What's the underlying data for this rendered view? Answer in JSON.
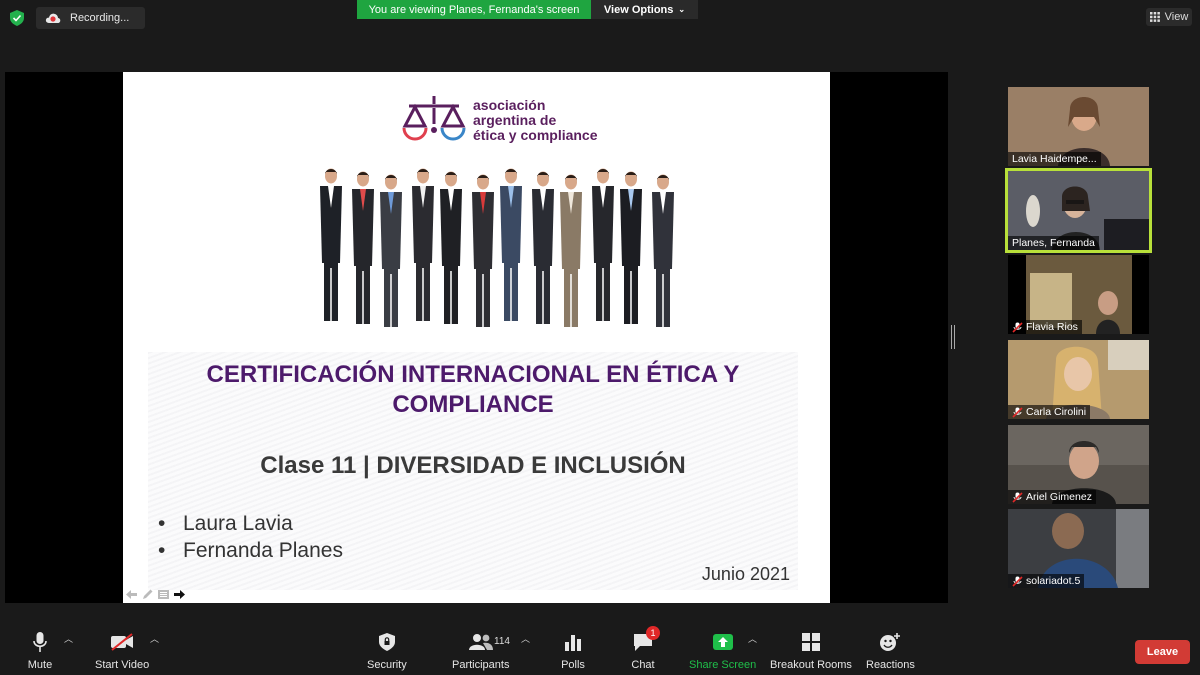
{
  "top_bar": {
    "recording_label": "Recording...",
    "viewing_banner": "You are viewing Planes, Fernanda's screen",
    "view_options_label": "View Options",
    "view_label": "View"
  },
  "slide": {
    "logo_lines": [
      "asociación",
      "argentina de",
      "ética y compliance"
    ],
    "title_line1": "CERTIFICACIÓN INTERNACIONAL EN ÉTICA Y",
    "title_line2": "COMPLIANCE",
    "subtitle": "Clase 11 | DIVERSIDAD E INCLUSIÓN",
    "presenters": [
      "Laura Lavia",
      "Fernanda Planes"
    ],
    "date": "Junio 2021"
  },
  "participants": [
    {
      "name": "Lavia Haidempe...",
      "muted": false,
      "active": false,
      "bg": "#9a7f66"
    },
    {
      "name": "Planes, Fernanda",
      "muted": false,
      "active": true,
      "bg": "#5b5d66"
    },
    {
      "name": "Flavia Rios",
      "muted": true,
      "active": false,
      "bg": "#6b5a3e"
    },
    {
      "name": "Carla Cirolini",
      "muted": true,
      "active": false,
      "bg": "#b59a6e"
    },
    {
      "name": "Ariel Gimenez",
      "muted": true,
      "active": false,
      "bg": "#57524c"
    },
    {
      "name": "solariadot.5",
      "muted": true,
      "active": false,
      "bg": "#3c3e42"
    }
  ],
  "toolbar": {
    "mute": "Mute",
    "start_video": "Start Video",
    "security": "Security",
    "participants": "Participants",
    "participant_count": "114",
    "polls": "Polls",
    "chat": "Chat",
    "chat_badge": "1",
    "share_screen": "Share Screen",
    "breakout_rooms": "Breakout Rooms",
    "reactions": "Reactions",
    "leave": "Leave"
  },
  "colors": {
    "share_green": "#1fa540",
    "active_speaker": "#b8e03a",
    "leave_red": "#d23b35",
    "slide_title": "#4d1a6b"
  }
}
